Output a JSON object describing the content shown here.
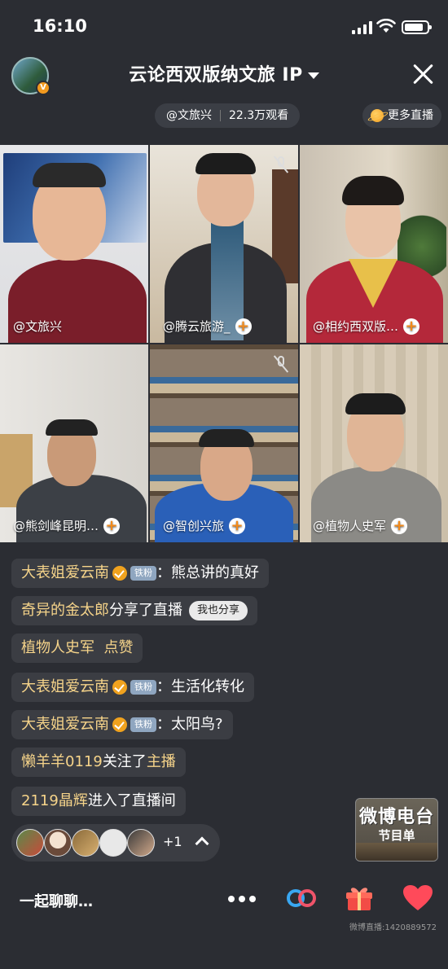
{
  "status_bar": {
    "time": "16:10"
  },
  "header": {
    "title": "云论西双版纳文旅 IP",
    "host": "@文旅兴",
    "viewers": "22.3万观看",
    "more_live": "更多直播"
  },
  "tiles": [
    {
      "name": "@文旅兴",
      "follow": false,
      "mic_muted": false
    },
    {
      "name": "@腾云旅游_",
      "follow": true,
      "mic_muted": true
    },
    {
      "name": "@相约西双版…",
      "follow": true,
      "mic_muted": false
    },
    {
      "name": "@熊剑峰昆明…",
      "follow": true,
      "mic_muted": false
    },
    {
      "name": "@智创兴旅",
      "follow": true,
      "mic_muted": true
    },
    {
      "name": "@植物人史军",
      "follow": true,
      "mic_muted": false
    }
  ],
  "follow_symbol": "+",
  "chat": [
    {
      "user": "大表姐爱云南",
      "verified": true,
      "badge": "铁粉",
      "text": "：熊总讲的真好"
    },
    {
      "user": "奇异的金太郎",
      "text": "分享了直播",
      "chip": "我也分享"
    },
    {
      "user": "植物人史军",
      "text": "  点赞"
    },
    {
      "user": "大表姐爱云南",
      "verified": true,
      "badge": "铁粉",
      "text": "：生活化转化"
    },
    {
      "user": "大表姐爱云南",
      "verified": true,
      "badge": "铁粉",
      "text": "：太阳鸟?"
    },
    {
      "user": "懒羊羊0119",
      "text": "关注了",
      "highlight": "主播"
    },
    {
      "user": "2119晶辉",
      "text": "进入了直播间"
    }
  ],
  "viewer_bar": {
    "extra_count": "+1"
  },
  "radio_card": {
    "line1": "微博电台",
    "line2": "节目单"
  },
  "bottom": {
    "input_placeholder": "一起聊聊…",
    "watermark": "微博直播:1420889572"
  },
  "colors": {
    "username": "#f6d48a",
    "accent": "#f28a1a",
    "background": "#2b2d33"
  }
}
